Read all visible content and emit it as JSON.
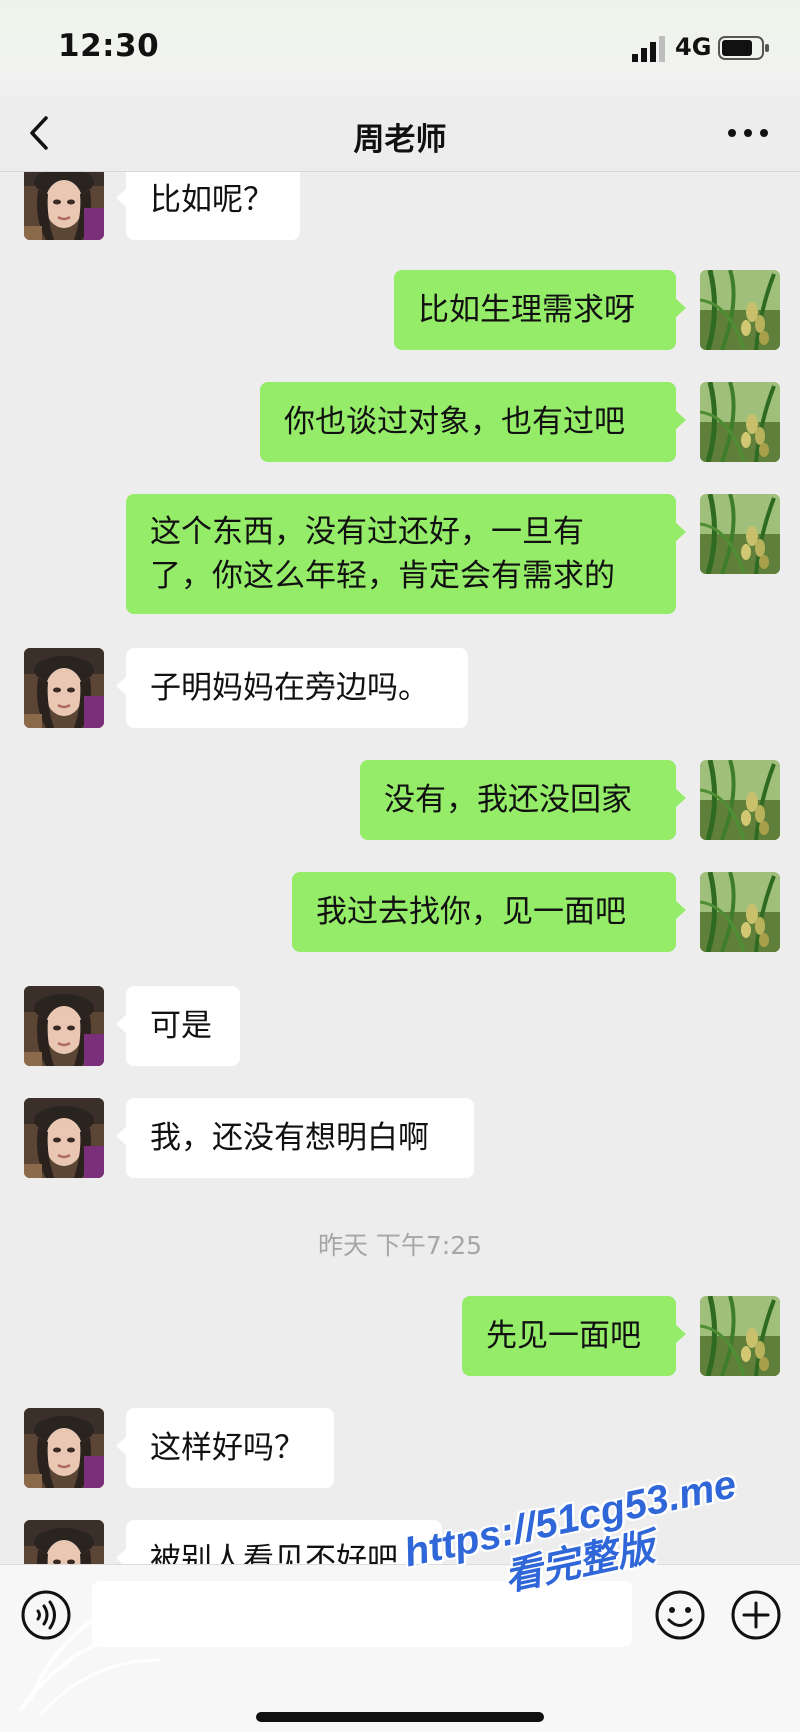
{
  "status_bar": {
    "time": "12:30",
    "network": "4G",
    "icons": [
      "signal-icon",
      "battery-icon"
    ]
  },
  "nav": {
    "title": "周老师",
    "icons": [
      "chevron-left-icon",
      "more-icon"
    ]
  },
  "messages": [
    {
      "side": "in",
      "text": "比如呢？"
    },
    {
      "side": "out",
      "text": "比如生理需求呀"
    },
    {
      "side": "out",
      "text": "你也谈过对象，也有过吧"
    },
    {
      "side": "out",
      "lines": [
        "这个东西，没有过还好，一旦有",
        "了，你这么年轻，肯定会有需求的"
      ]
    },
    {
      "side": "in",
      "text": "子明妈妈在旁边吗。"
    },
    {
      "side": "out",
      "text": "没有，我还没回家"
    },
    {
      "side": "out",
      "text": "我过去找你，见一面吧"
    },
    {
      "side": "in",
      "text": "可是"
    },
    {
      "side": "in",
      "text": "我，还没有想明白啊"
    },
    {
      "side": "time",
      "text": "昨天 下午7:25"
    },
    {
      "side": "out",
      "text": "先见一面吧"
    },
    {
      "side": "in",
      "text": "这样好吗？"
    },
    {
      "side": "in",
      "text": "被别人看见不好吧"
    }
  ],
  "input_bar": {
    "placeholder": "",
    "icons": [
      "voice-icon",
      "emoji-icon",
      "plus-icon"
    ]
  },
  "watermark": {
    "url": "https://51cg53.me",
    "caption": "看完整版"
  },
  "colors": {
    "background": "#ededed",
    "incoming_bubble": "#ffffff",
    "outgoing_bubble": "#95ec69",
    "timestamp": "#a6a6a6",
    "watermark": "#2f66d8"
  }
}
